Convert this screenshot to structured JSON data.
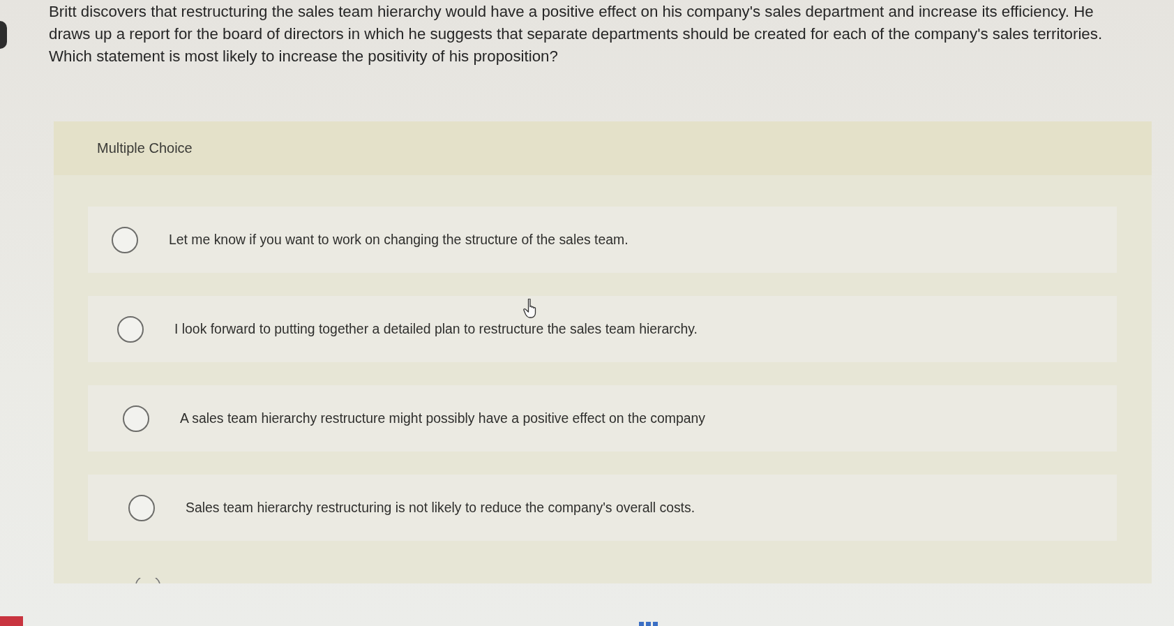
{
  "question": {
    "text": "Britt discovers that restructuring the sales team hierarchy would have a positive effect on his company's sales department and increase its efficiency. He draws up a report for the board of directors in which he suggests that separate departments should be created for each of the company's sales territories. Which statement is most likely to increase the positivity of his proposition?"
  },
  "card": {
    "heading": "Multiple Choice",
    "options": [
      {
        "label": "Let me know if you want to work on changing the structure of the sales team.",
        "selected": false
      },
      {
        "label": "I look forward to putting together a detailed plan to restructure the sales team hierarchy.",
        "selected": false
      },
      {
        "label": "A sales team hierarchy restructure might possibly have a positive effect on the company",
        "selected": false
      },
      {
        "label": "Sales team hierarchy restructuring is not likely to reduce the company's overall costs.",
        "selected": false
      }
    ]
  }
}
